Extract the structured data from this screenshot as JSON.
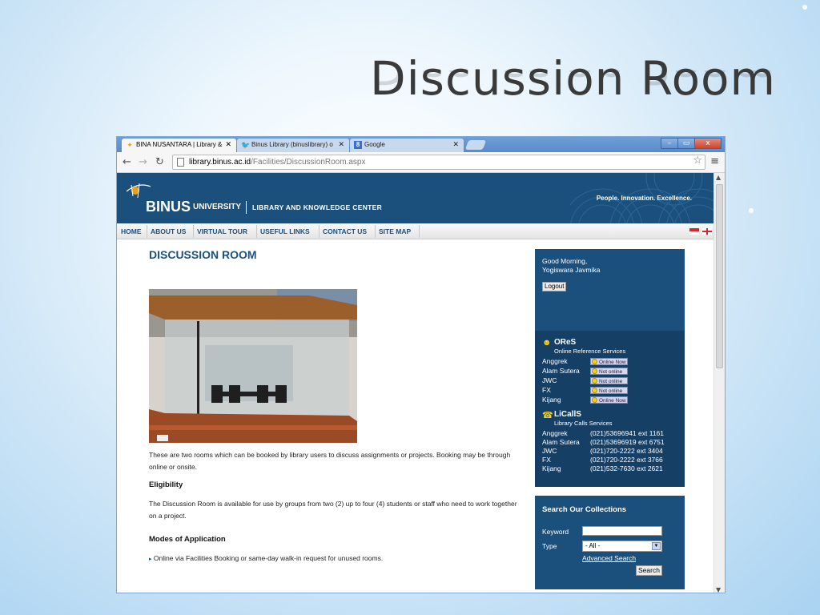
{
  "slide": {
    "title": "Discussion Room"
  },
  "browser": {
    "tabs": [
      {
        "label": "BINA NUSANTARA | Library &"
      },
      {
        "label": "Binus Library (binuslibrary) o"
      },
      {
        "label": "Google"
      }
    ],
    "window_controls": {
      "minimize": "–",
      "maximize": "▭",
      "close": "x"
    },
    "url": {
      "host": "library.binus.ac.id",
      "path": "/Facilities/DiscussionRoom.aspx"
    }
  },
  "site": {
    "logo": {
      "binus": "BINUS",
      "university": "UNIVERSITY",
      "center": "LIBRARY AND KNOWLEDGE CENTER"
    },
    "tagline": "People. Innovation. Excellence.",
    "nav": [
      "HOME",
      "ABOUT US",
      "VIRTUAL TOUR",
      "USEFUL LINKS",
      "CONTACT US",
      "SITE MAP"
    ],
    "page_title": "DISCUSSION ROOM",
    "intro": "These are two rooms which can be booked by library users to discuss assignments or projects. Booking may be through online or onsite.",
    "eligibility": {
      "heading": "Eligibility",
      "text": "The Discussion Room is available for use by groups from two (2) up to four (4) students or staff who need to work together on a project."
    },
    "modes": {
      "heading": "Modes of Application",
      "items": [
        "Online via Facilities Booking or same-day walk-in request for unused rooms."
      ]
    }
  },
  "sidebar": {
    "greeting_line1": "Good Morning,",
    "greeting_line2": "Yogiswara Javmika",
    "logout_label": "Logout",
    "ores": {
      "title": "OReS",
      "subtitle": "Online Reference Services",
      "rows": [
        {
          "campus": "Anggrek",
          "status": "Online Now"
        },
        {
          "campus": "Alam Sutera",
          "status": "Not online"
        },
        {
          "campus": "JWC",
          "status": "Not online"
        },
        {
          "campus": "FX",
          "status": "Not online"
        },
        {
          "campus": "Kijang",
          "status": "Online Now"
        }
      ]
    },
    "licalls": {
      "title": "LiCallS",
      "subtitle": "Library Calls Services",
      "rows": [
        {
          "campus": "Anggrek",
          "phone": "(021)53696941 ext 1161"
        },
        {
          "campus": "Alam Sutera",
          "phone": "(021)53696919 ext 6751"
        },
        {
          "campus": "JWC",
          "phone": "(021)720-2222 ext 3404"
        },
        {
          "campus": "FX",
          "phone": "(021)720-2222 ext 3766"
        },
        {
          "campus": "Kijang",
          "phone": "(021)532-7630 ext 2621"
        }
      ]
    },
    "search": {
      "title": "Search Our Collections",
      "keyword_label": "Keyword",
      "keyword_value": "",
      "type_label": "Type",
      "type_value": "- All -",
      "advanced_label": "Advanced Search",
      "button_label": "Search"
    }
  },
  "colors": {
    "brand_blue": "#1b4f7c",
    "tab_bar": "#5a8cc9",
    "online_dot": "#f2d12a"
  }
}
